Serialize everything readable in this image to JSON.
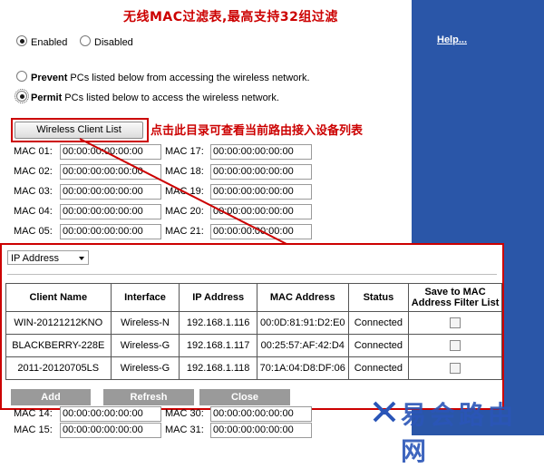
{
  "annotation_title": "无线MAC过滤表,最高支持32组过滤",
  "annotation_note": "点击此目录可查看当前路由接入设备列表",
  "help_link": "Help...",
  "filter_toggle": {
    "enabled": "Enabled",
    "disabled": "Disabled",
    "selected": "Enabled"
  },
  "mode": {
    "prevent_bold": "Prevent",
    "prevent_rest": " PCs listed below  from accessing the wireless network.",
    "permit_bold": "Permit",
    "permit_rest": " PCs listed below to access the wireless network.",
    "selected": "Permit"
  },
  "wireless_client_list_button": "Wireless Client List",
  "mac_left": [
    {
      "label": "MAC 01:",
      "value": "00:00:00:00:00:00"
    },
    {
      "label": "MAC 02:",
      "value": "00:00:00:00:00:00"
    },
    {
      "label": "MAC 03:",
      "value": "00:00:00:00:00:00"
    },
    {
      "label": "MAC 04:",
      "value": "00:00:00:00:00:00"
    },
    {
      "label": "MAC 05:",
      "value": "00:00:00:00:00:00"
    }
  ],
  "mac_right": [
    {
      "label": "MAC 17:",
      "value": "00:00:00:00:00:00"
    },
    {
      "label": "MAC 18:",
      "value": "00:00:00:00:00:00"
    },
    {
      "label": "MAC 19:",
      "value": "00:00:00:00:00:00"
    },
    {
      "label": "MAC 20:",
      "value": "00:00:00:00:00:00"
    },
    {
      "label": "MAC 21:",
      "value": "00:00:00:00:00:00"
    }
  ],
  "mac_bottom": [
    {
      "label": "MAC 14:",
      "value": "00:00:00:00:00:00"
    },
    {
      "label": "MAC 30:",
      "value": "00:00:00:00:00:00"
    },
    {
      "label": "MAC 15:",
      "value": "00:00:00:00:00:00"
    },
    {
      "label": "MAC 31:",
      "value": "00:00:00:00:00:00"
    }
  ],
  "popup": {
    "sort_select": "IP Address",
    "headers": [
      "Client Name",
      "Interface",
      "IP Address",
      "MAC Address",
      "Status",
      "Save to MAC Address Filter List"
    ],
    "rows": [
      [
        "WIN-20121212KNO",
        "Wireless-N",
        "192.168.1.116",
        "00:0D:81:91:D2:E0",
        "Connected"
      ],
      [
        "BLACKBERRY-228E",
        "Wireless-G",
        "192.168.1.117",
        "00:25:57:AF:42:D4",
        "Connected"
      ],
      [
        "2011-20120705LS",
        "Wireless-G",
        "192.168.1.118",
        "70:1A:04:D8:DF:06",
        "Connected"
      ]
    ],
    "buttons": {
      "add": "Add",
      "refresh": "Refresh",
      "close": "Close"
    }
  },
  "watermark": "易会路由网",
  "colors": {
    "annotation": "#cc0000",
    "side_panel": "#2a56a8",
    "button_gray": "#9a9a9a"
  }
}
